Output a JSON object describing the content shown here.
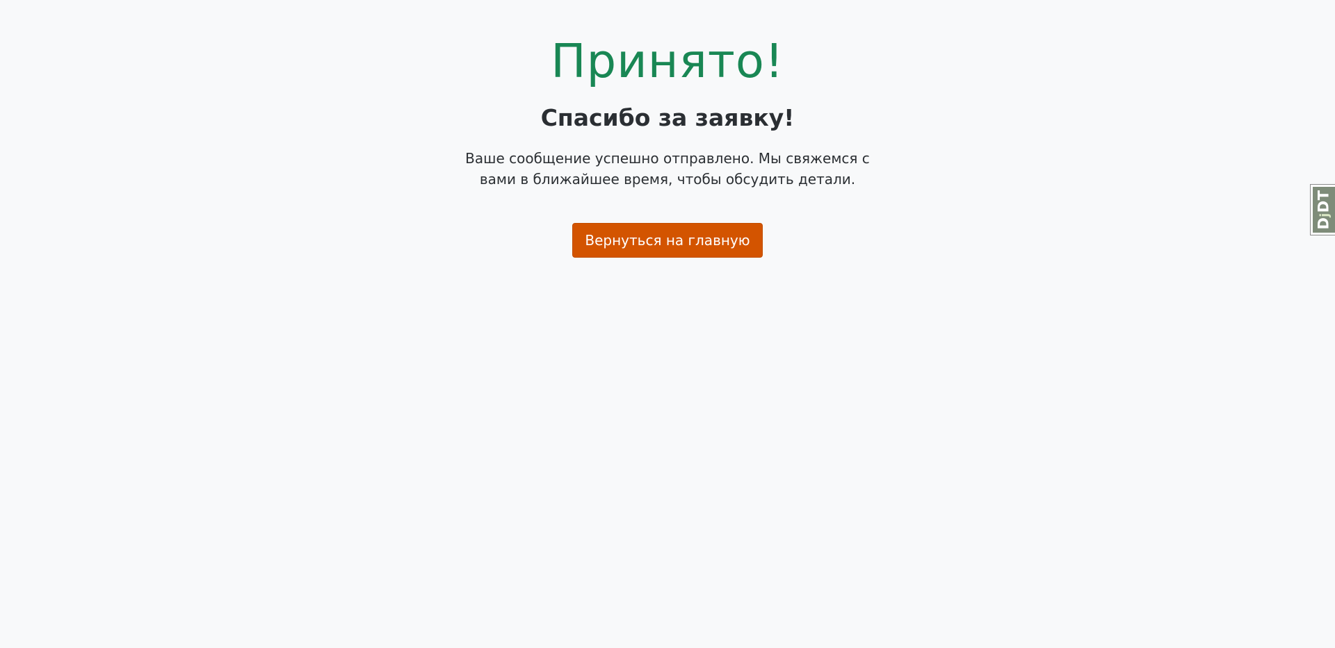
{
  "success": {
    "title": "Принято!",
    "subtitle": "Спасибо за заявку!",
    "message": "Ваше сообщение успешно отправлено. Мы свяжемся с вами в ближайшее время, чтобы обсудить детали.",
    "button_label": "Вернуться на главную"
  },
  "debug_toolbar": {
    "handle_first": "D",
    "handle_j": "j",
    "handle_rest": "DT"
  },
  "colors": {
    "title": "#198754",
    "button": "#d35400",
    "background": "#f8f9fa"
  }
}
